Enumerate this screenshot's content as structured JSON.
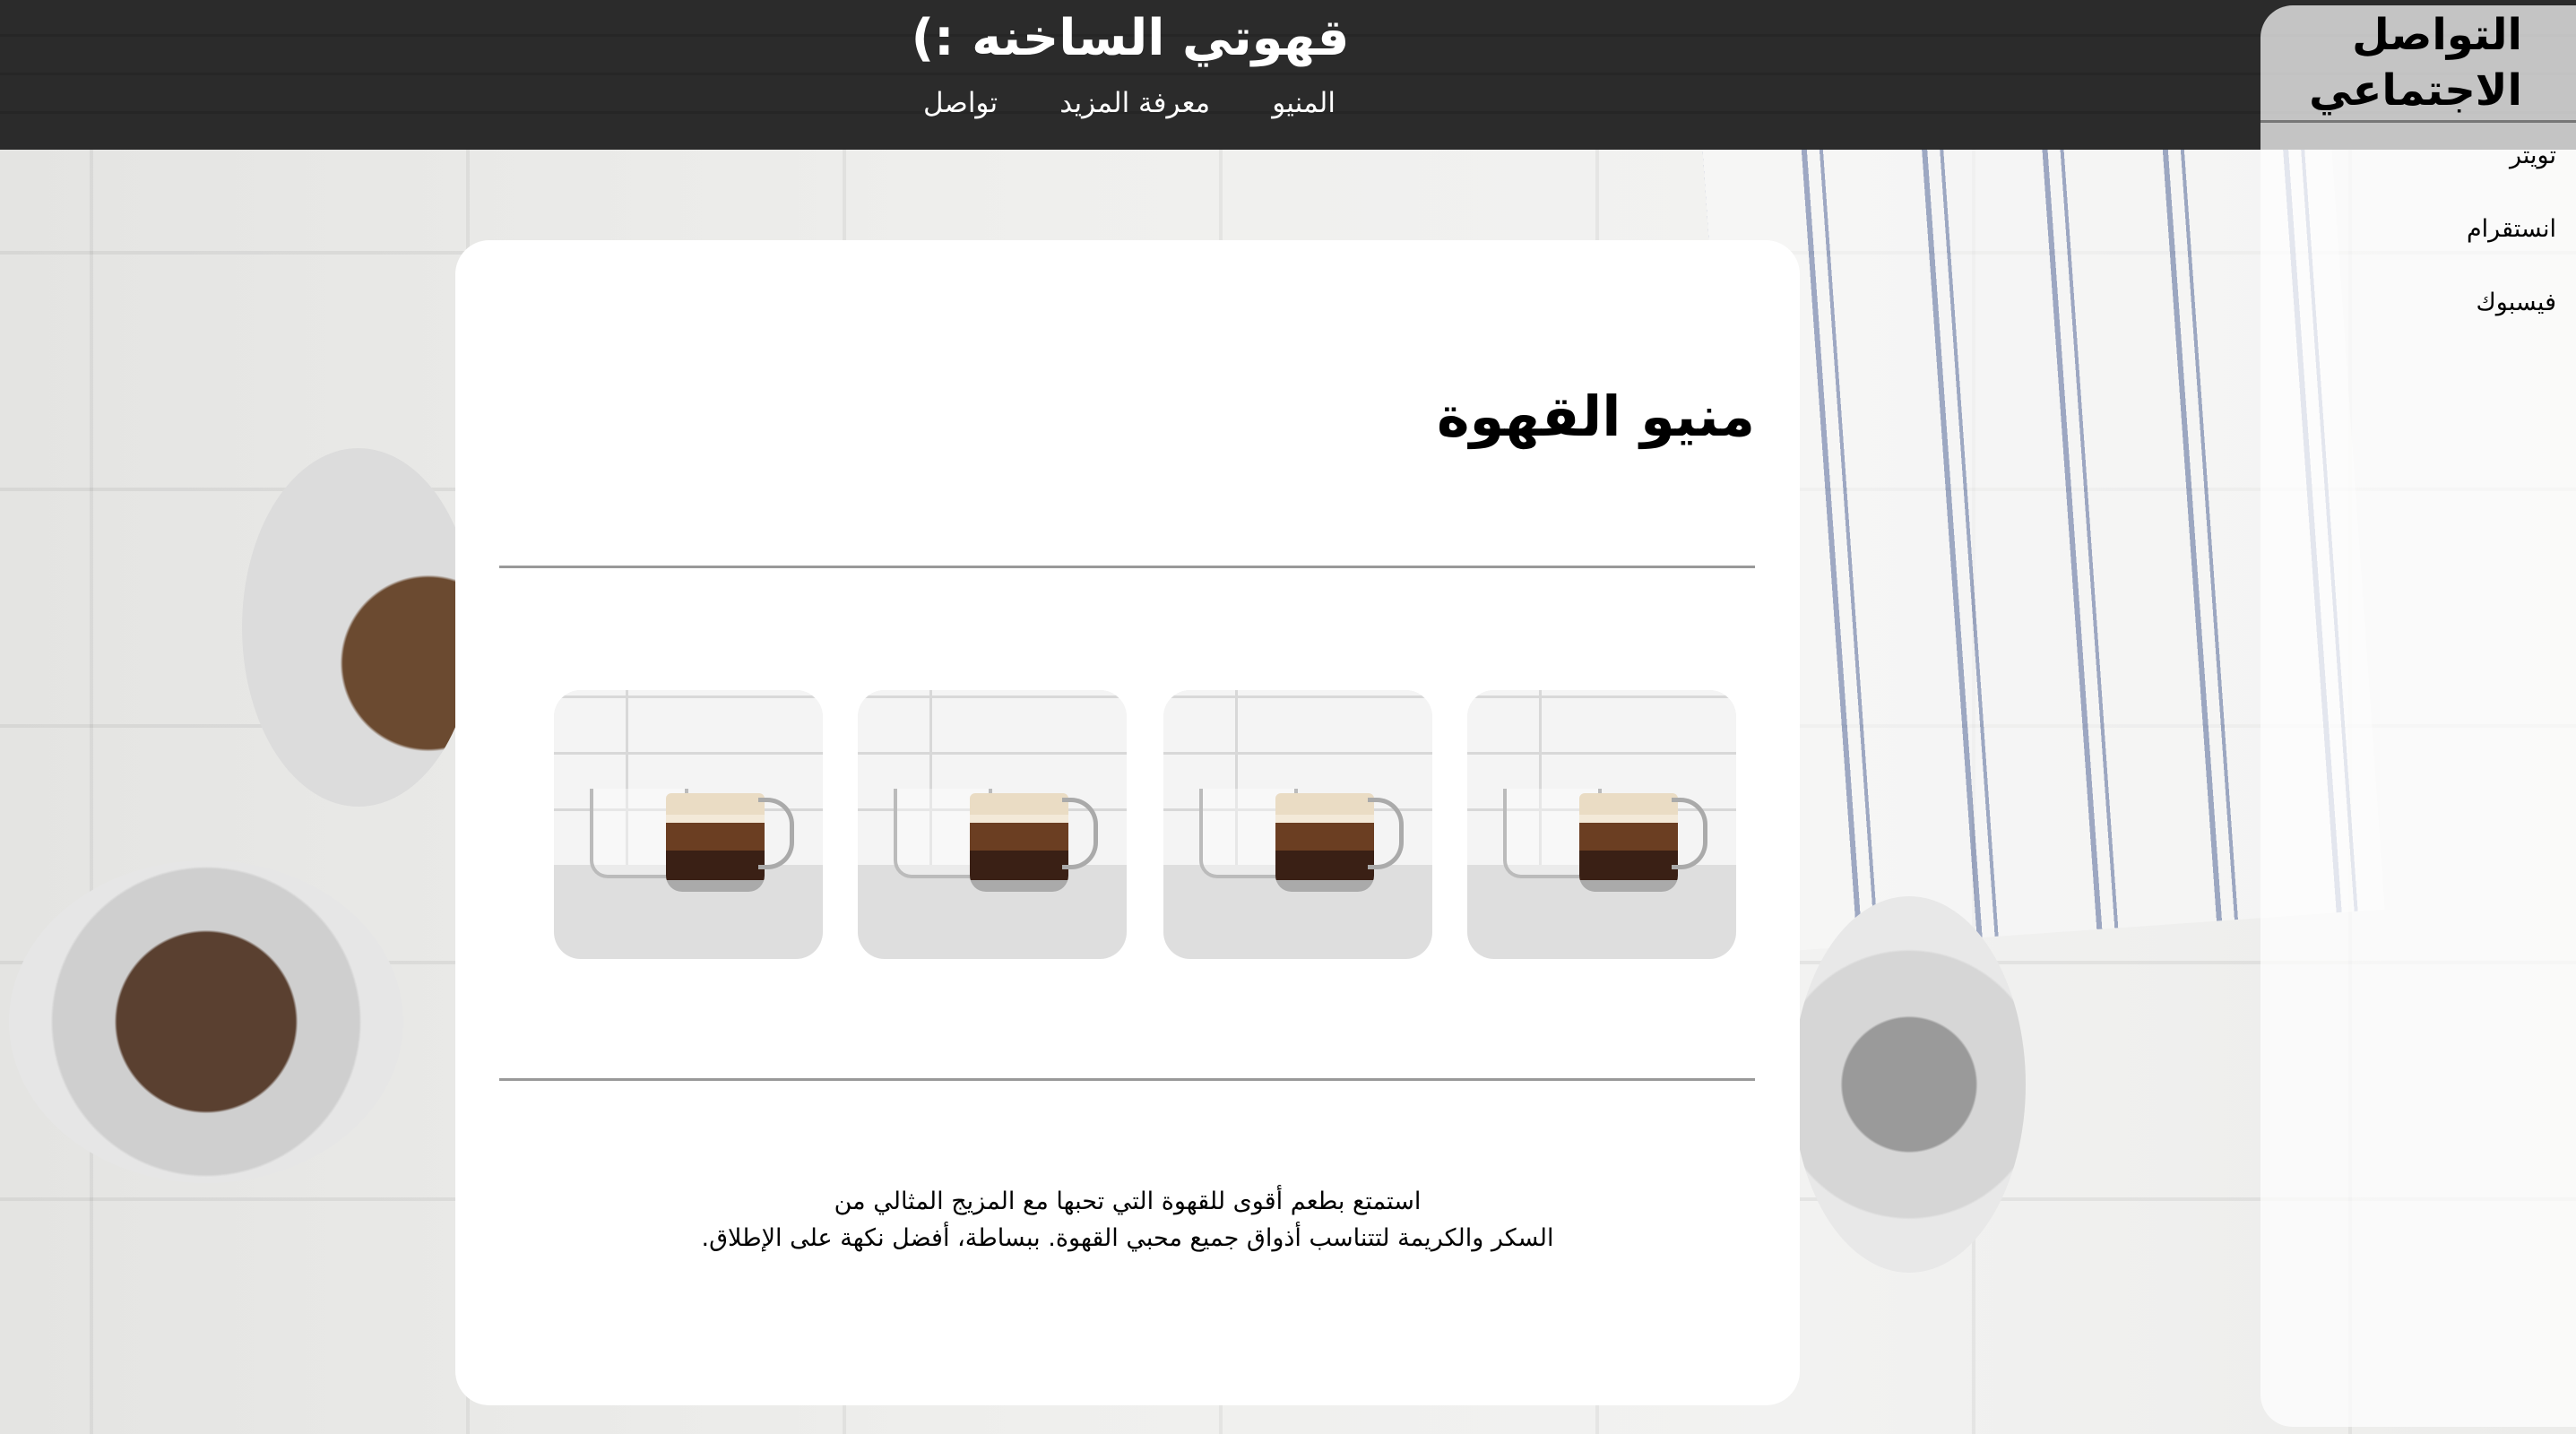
{
  "header": {
    "title": "قهوتي الساخنه :)",
    "nav": [
      "المنيو",
      "معرفة المزيد",
      "تواصل"
    ]
  },
  "sidebar": {
    "title_line1": "التواصل",
    "title_line2": "الاجتماعي",
    "links": [
      "تويتر",
      "انستقرام",
      "فيسبوك"
    ]
  },
  "main": {
    "title": "منيو القهوة",
    "description_line1": "استمتع بطعم أقوى للقهوة التي تحبها مع المزيج المثالي من",
    "description_line2": "السكر والكريمة لتتناسب أذواق جميع محبي القهوة. ببساطة، أفضل نكهة على الإطلاق."
  }
}
